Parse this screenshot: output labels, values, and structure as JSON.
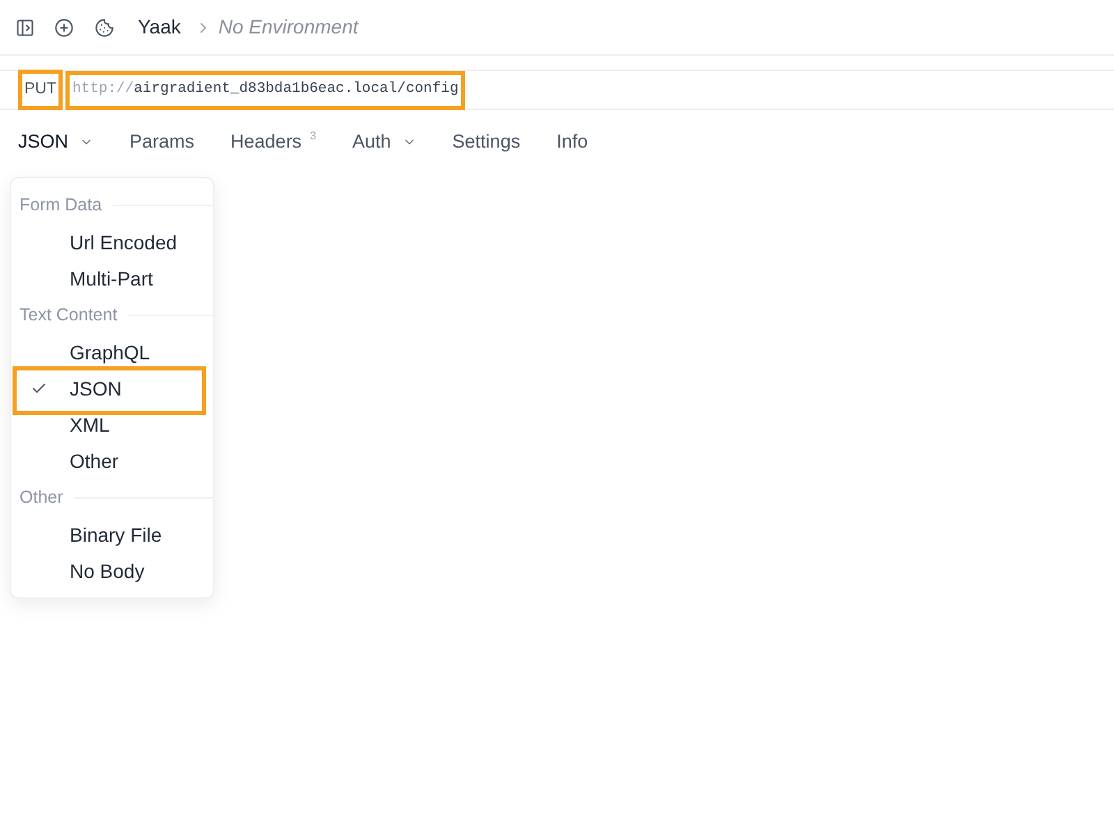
{
  "header": {
    "app_name": "Yaak",
    "environment": "No Environment"
  },
  "request": {
    "method": {
      "label": "PUT",
      "highlighted": true
    },
    "url": {
      "scheme": "http://",
      "address": "airgradient_d83bda1b6eac.local/config",
      "highlighted": true
    }
  },
  "tabs": [
    {
      "label": "JSON",
      "selected": true,
      "has_menu": true
    },
    {
      "label": "Params",
      "selected": false,
      "has_menu": false
    },
    {
      "label": "Headers",
      "selected": false,
      "has_menu": false,
      "count": "3"
    },
    {
      "label": "Auth",
      "selected": false,
      "has_menu": true
    },
    {
      "label": "Settings",
      "selected": false,
      "has_menu": false
    },
    {
      "label": "Info",
      "selected": false,
      "has_menu": false
    }
  ],
  "body_type_menu": {
    "sections": [
      {
        "heading": "Form Data",
        "items": [
          {
            "label": "Url Encoded",
            "checked": false,
            "highlighted": false
          },
          {
            "label": "Multi-Part",
            "checked": false,
            "highlighted": false
          }
        ]
      },
      {
        "heading": "Text Content",
        "items": [
          {
            "label": "GraphQL",
            "checked": false,
            "highlighted": false
          },
          {
            "label": "JSON",
            "checked": true,
            "highlighted": true
          },
          {
            "label": "XML",
            "checked": false,
            "highlighted": false
          },
          {
            "label": "Other",
            "checked": false,
            "highlighted": false
          }
        ]
      },
      {
        "heading": "Other",
        "items": [
          {
            "label": "Binary File",
            "checked": false,
            "highlighted": false
          },
          {
            "label": "No Body",
            "checked": false,
            "highlighted": false
          }
        ]
      }
    ]
  }
}
